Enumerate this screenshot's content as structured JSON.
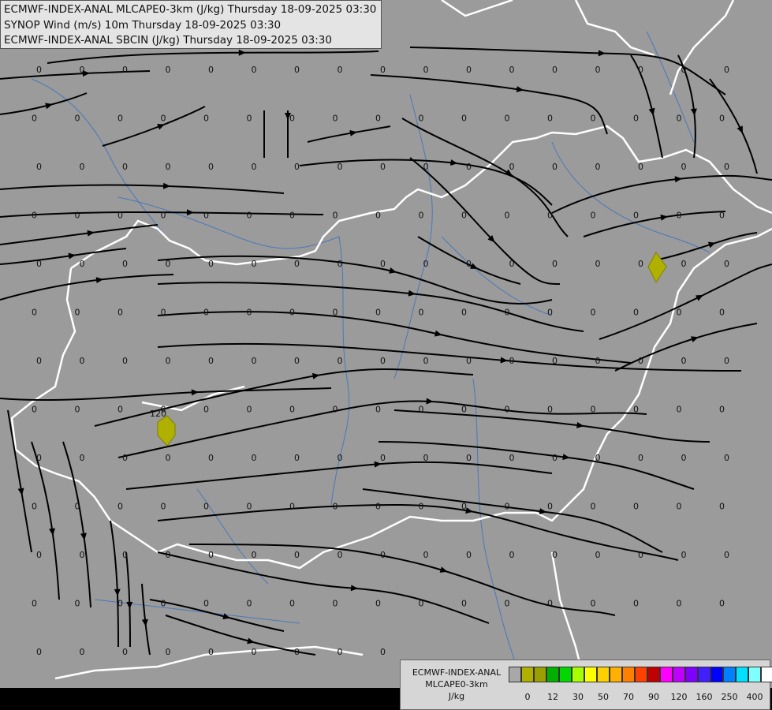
{
  "header": {
    "line1": "ECMWF-INDEX-ANAL MLCAPE0-3km (J/kg) Thursday 18-09-2025 03:30",
    "line2": "SYNOP Wind (m/s) 10m Thursday 18-09-2025 03:30",
    "line3": "ECMWF-INDEX-ANAL SBCIN (J/kg) Thursday 18-09-2025 03:30"
  },
  "legend": {
    "title1": "ECMWF-INDEX-ANAL",
    "title2": "MLCAPE0-3km",
    "unit": "J/kg",
    "colors": [
      "#a8a8a8",
      "#b0b000",
      "#9aa000",
      "#00b000",
      "#00d800",
      "#a8ff00",
      "#ffff00",
      "#ffd000",
      "#ffb000",
      "#ff8000",
      "#ff4000",
      "#c00000",
      "#ff00ff",
      "#c000ff",
      "#8000ff",
      "#4020ff",
      "#0000ff",
      "#0080ff",
      "#00e0ff",
      "#80ffff",
      "#ffffff"
    ],
    "labels": [
      "0",
      "12",
      "30",
      "50",
      "70",
      "90",
      "120",
      "160",
      "250",
      "400"
    ]
  },
  "map": {
    "cin_value": "0",
    "cape_label": "120",
    "land_color": "#9b9b9b",
    "border_color": "#ffffff",
    "river_color": "#4a78b8",
    "streamline_color": "#000000",
    "cape_color": "#b0b000"
  }
}
